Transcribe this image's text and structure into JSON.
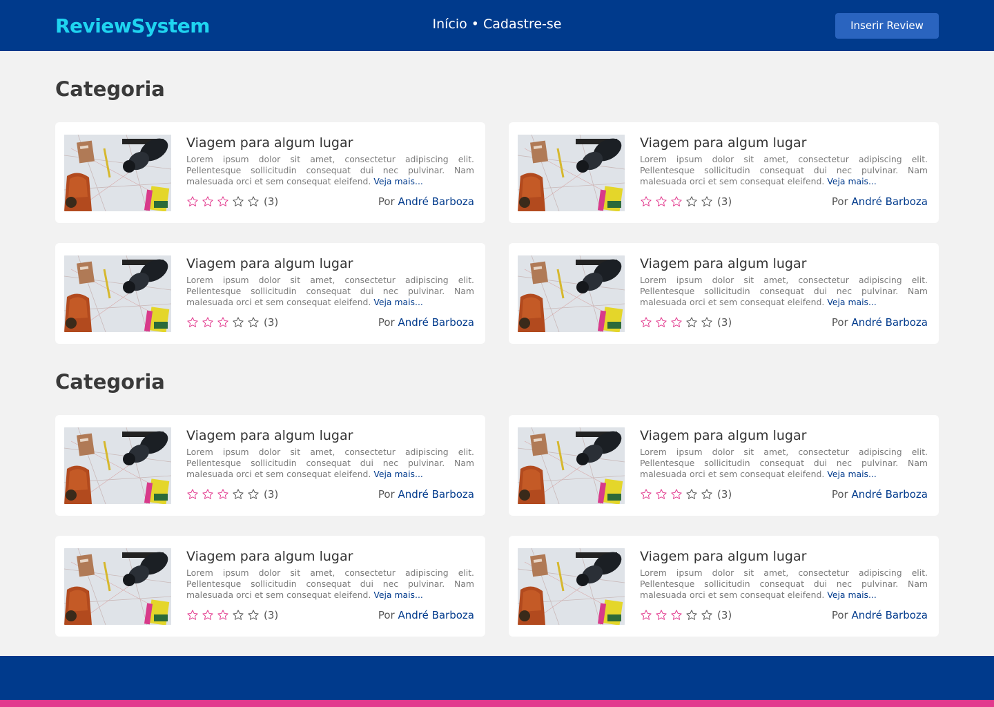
{
  "header": {
    "brand": "ReviewSystem",
    "nav": [
      {
        "label": "Início"
      },
      {
        "label": "Cadastre-se"
      }
    ],
    "nav_separator": "•",
    "insert_button": "Inserir Review"
  },
  "colors": {
    "primary": "#003a8c",
    "brand_text": "#1fd4f0",
    "button": "#2a64bf",
    "star_filled": "#e23a8e",
    "accent_stripe": "#e23a8e"
  },
  "sections": [
    {
      "title": "Categoria",
      "cards": [
        {
          "title": "Viagem para algum lugar",
          "description": "Lorem ipsum dolor sit amet, consectetur adipiscing elit. Pellentesque sollicitudin consequat dui nec pulvinar. Nam malesuada orci et sem consequat eleifend.",
          "more": "Veja mais...",
          "rating": 3,
          "max_rating": 5,
          "count": "(3)",
          "author_prefix": "Por",
          "author": "André Barboza"
        },
        {
          "title": "Viagem para algum lugar",
          "description": "Lorem ipsum dolor sit amet, consectetur adipiscing elit. Pellentesque sollicitudin consequat dui nec pulvinar. Nam malesuada orci et sem consequat eleifend.",
          "more": "Veja mais...",
          "rating": 3,
          "max_rating": 5,
          "count": "(3)",
          "author_prefix": "Por",
          "author": "André Barboza"
        },
        {
          "title": "Viagem para algum lugar",
          "description": "Lorem ipsum dolor sit amet, consectetur adipiscing elit. Pellentesque sollicitudin consequat dui nec pulvinar. Nam malesuada orci et sem consequat eleifend.",
          "more": "Veja mais...",
          "rating": 3,
          "max_rating": 5,
          "count": "(3)",
          "author_prefix": "Por",
          "author": "André Barboza"
        },
        {
          "title": "Viagem para algum lugar",
          "description": "Lorem ipsum dolor sit amet, consectetur adipiscing elit. Pellentesque sollicitudin consequat dui nec pulvinar. Nam malesuada orci et sem consequat eleifend.",
          "more": "Veja mais...",
          "rating": 3,
          "max_rating": 5,
          "count": "(3)",
          "author_prefix": "Por",
          "author": "André Barboza"
        }
      ]
    },
    {
      "title": "Categoria",
      "cards": [
        {
          "title": "Viagem para algum lugar",
          "description": "Lorem ipsum dolor sit amet, consectetur adipiscing elit. Pellentesque sollicitudin consequat dui nec pulvinar. Nam malesuada orci et sem consequat eleifend.",
          "more": "Veja mais...",
          "rating": 3,
          "max_rating": 5,
          "count": "(3)",
          "author_prefix": "Por",
          "author": "André Barboza"
        },
        {
          "title": "Viagem para algum lugar",
          "description": "Lorem ipsum dolor sit amet, consectetur adipiscing elit. Pellentesque sollicitudin consequat dui nec pulvinar. Nam malesuada orci et sem consequat eleifend.",
          "more": "Veja mais...",
          "rating": 3,
          "max_rating": 5,
          "count": "(3)",
          "author_prefix": "Por",
          "author": "André Barboza"
        },
        {
          "title": "Viagem para algum lugar",
          "description": "Lorem ipsum dolor sit amet, consectetur adipiscing elit. Pellentesque sollicitudin consequat dui nec pulvinar. Nam malesuada orci et sem consequat eleifend.",
          "more": "Veja mais...",
          "rating": 3,
          "max_rating": 5,
          "count": "(3)",
          "author_prefix": "Por",
          "author": "André Barboza"
        },
        {
          "title": "Viagem para algum lugar",
          "description": "Lorem ipsum dolor sit amet, consectetur adipiscing elit. Pellentesque sollicitudin consequat dui nec pulvinar. Nam malesuada orci et sem consequat eleifend.",
          "more": "Veja mais...",
          "rating": 3,
          "max_rating": 5,
          "count": "(3)",
          "author_prefix": "Por",
          "author": "André Barboza"
        }
      ]
    }
  ]
}
